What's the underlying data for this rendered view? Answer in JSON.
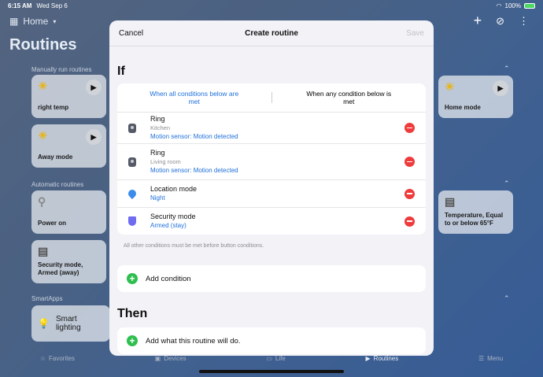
{
  "status": {
    "time": "6:15 AM",
    "date": "Wed Sep 6",
    "battery": "100%"
  },
  "header": {
    "home_label": "Home",
    "title": "Routines"
  },
  "background": {
    "manual_label": "Manually run routines",
    "automatic_label": "Automatic routines",
    "smartapps_label": "SmartApps",
    "cards": {
      "right_temp": "right temp",
      "away_mode": "Away mode",
      "power_on": "Power on",
      "security_mode": "Security mode, Armed (away)",
      "smart_lighting": "Smart lighting",
      "home_mode": "Home mode",
      "temperature": "Temperature, Equal to or below 65°F"
    }
  },
  "tabs": {
    "favorites": "Favorites",
    "devices": "Devices",
    "life": "Life",
    "routines": "Routines",
    "menu": "Menu"
  },
  "modal": {
    "cancel": "Cancel",
    "title": "Create routine",
    "save": "Save",
    "if_heading": "If",
    "seg_all": "When all conditions below are met",
    "seg_any": "When any condition below is met",
    "conditions": [
      {
        "name": "Ring",
        "sub": "Kitchen",
        "value": "Motion sensor: Motion detected"
      },
      {
        "name": "Ring",
        "sub": "Living room",
        "value": "Motion sensor: Motion detected"
      },
      {
        "name": "Location mode",
        "sub": "",
        "value": "Night"
      },
      {
        "name": "Security mode",
        "sub": "",
        "value": "Armed (stay)"
      }
    ],
    "note": "All other conditions must be met before button conditions.",
    "add_condition": "Add condition",
    "then_heading": "Then",
    "add_action": "Add what this routine will do."
  },
  "colors": {
    "accent": "#1e6fd9",
    "remove": "#ef3b3b",
    "add": "#2fbf4f"
  }
}
